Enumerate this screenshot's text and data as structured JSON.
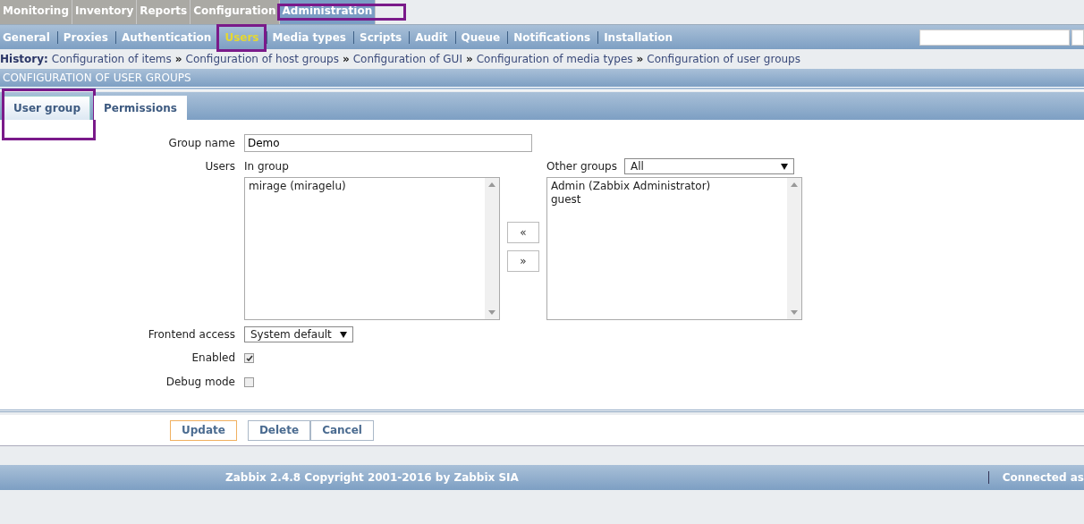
{
  "main_menu": [
    {
      "label": "Monitoring",
      "selected": false,
      "highlighted": false
    },
    {
      "label": "Inventory",
      "selected": false,
      "highlighted": false
    },
    {
      "label": "Reports",
      "selected": false,
      "highlighted": false
    },
    {
      "label": "Configuration",
      "selected": false,
      "highlighted": false
    },
    {
      "label": "Administration",
      "selected": true,
      "highlighted": true
    }
  ],
  "sub_menu": [
    {
      "label": "General",
      "selected": false,
      "highlighted": false
    },
    {
      "label": "Proxies",
      "selected": false,
      "highlighted": false
    },
    {
      "label": "Authentication",
      "selected": false,
      "highlighted": false
    },
    {
      "label": "Users",
      "selected": true,
      "highlighted": true
    },
    {
      "label": "Media types",
      "selected": false,
      "highlighted": false
    },
    {
      "label": "Scripts",
      "selected": false,
      "highlighted": false
    },
    {
      "label": "Audit",
      "selected": false,
      "highlighted": false
    },
    {
      "label": "Queue",
      "selected": false,
      "highlighted": false
    },
    {
      "label": "Notifications",
      "selected": false,
      "highlighted": false
    },
    {
      "label": "Installation",
      "selected": false,
      "highlighted": false
    }
  ],
  "history": {
    "label": "History:",
    "separator": "»",
    "items": [
      "Configuration of items",
      "Configuration of host groups",
      "Configuration of GUI",
      "Configuration of media types",
      "Configuration of user groups"
    ]
  },
  "page_title": "CONFIGURATION OF USER GROUPS",
  "tabs": [
    {
      "label": "User group",
      "selected": true,
      "highlighted": true
    },
    {
      "label": "Permissions",
      "selected": false,
      "highlighted": false
    }
  ],
  "form": {
    "group_name": {
      "label": "Group name",
      "value": "Demo"
    },
    "users": {
      "label": "Users",
      "in_group_label": "In group",
      "in_group": [
        "mirage (miragelu)"
      ],
      "move_left": "«",
      "move_right": "»",
      "other_groups_label": "Other groups",
      "other_groups_filter": "All",
      "other_groups": [
        "Admin (Zabbix Administrator)",
        "guest"
      ]
    },
    "frontend_access": {
      "label": "Frontend access",
      "value": "System default"
    },
    "enabled": {
      "label": "Enabled",
      "checked": true
    },
    "debug_mode": {
      "label": "Debug mode",
      "checked": false
    }
  },
  "buttons": [
    {
      "label": "Update",
      "kind": "primary"
    },
    {
      "label": "Delete",
      "kind": "secondary"
    },
    {
      "label": "Cancel",
      "kind": "secondary"
    }
  ],
  "footer": {
    "copyright": "Zabbix 2.4.8 Copyright 2001-2016 by Zabbix SIA",
    "connected": "Connected as"
  }
}
